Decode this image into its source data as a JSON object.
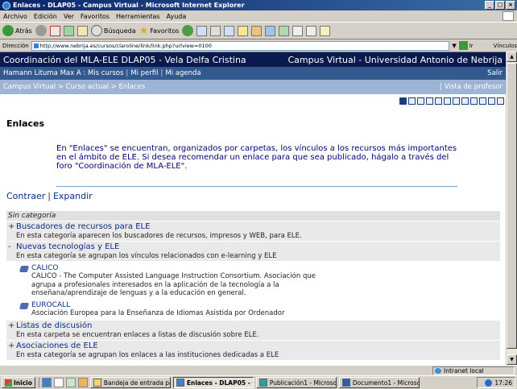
{
  "window": {
    "title": "Enlaces - DLAP05 - Campus Virtual - Microsoft Internet Explorer",
    "controls": [
      "_",
      "□",
      "×"
    ]
  },
  "menu": [
    "Archivo",
    "Edición",
    "Ver",
    "Favoritos",
    "Herramientas",
    "Ayuda"
  ],
  "toolbar": {
    "back_label": "Atrás",
    "search_label": "Búsqueda",
    "favorites_label": "Favoritos"
  },
  "address": {
    "label": "Dirección",
    "url": "http://www.nebrija.es/cursos/claroline/link/link.php?urlview=0100",
    "go_label": "Ir",
    "links_label": "Vínculos"
  },
  "banner": {
    "course": "Coordinación del MLA-ELE DLAP05 - Vela Delfa Cristina",
    "campus": "Campus Virtual - Universidad Antonio de Nebrija"
  },
  "userbar": {
    "user": "Hamann Lituma Max A :",
    "links": [
      "Mis cursos",
      "Mi perfil",
      "Mi agenda"
    ],
    "logout": "Salir"
  },
  "breadcrumb": {
    "path": "Campus Virtual > Curso actual > Enlaces",
    "teacher_view": "|  Vista de profesor"
  },
  "page": {
    "title": "Enlaces",
    "intro": "En \"Enlaces\" se encuentran, organizados por carpetas, los vínculos a los recursos más importantes en el ámbito de ELE. Si desea recomendar un enlace para que sea publicado, hágalo a través del foro \"Coordinación de MLA-ELE\".",
    "contraer": "Contraer",
    "pipe": "|",
    "expandir": "Expandir"
  },
  "categories": {
    "header": "Sin categoría",
    "items": [
      {
        "toggle": "+",
        "title": "Buscadores de recursos para ELE",
        "desc": "En esta categoría aparecen los buscadores de recursos, impresos y WEB, para ELE."
      },
      {
        "toggle": "-",
        "title": "Nuevas tecnologías y ELE",
        "desc": "En esta categoría se agrupan los vínculos relacionados con e-learning y ELE"
      },
      {
        "toggle": "+",
        "title": "Listas de discusión",
        "desc": "En esta carpeta se encuentran enlaces a listas de discusión sobre ELE."
      },
      {
        "toggle": "+",
        "title": "Asociaciones de ELE",
        "desc": "En esta categoría se agrupan los enlaces a las instituciones dedicadas a ELE"
      }
    ],
    "links": [
      {
        "title": "CALICO",
        "desc": "CALICO - The Computer Assisted Language Instruction Consortium. Asociación que agrupa a profesionales interesados en la aplicación de la tecnología a la enseñana/aprendizaje de lenguas y a la educación en general."
      },
      {
        "title": "EUROCALL",
        "desc": "Asociación Europea para la Enseñanza de Idiomas Asistida por Ordenador"
      }
    ]
  },
  "status": {
    "zone": "Intranet local"
  },
  "taskbar": {
    "start": "Inicio",
    "tasks": [
      "Bandeja de entrada para ...",
      "Enlaces - DLAP05 - Ca...",
      "Publicación1 - Microsoft ...",
      "Documento1 - Microsoft ..."
    ],
    "clock": "17:26"
  }
}
